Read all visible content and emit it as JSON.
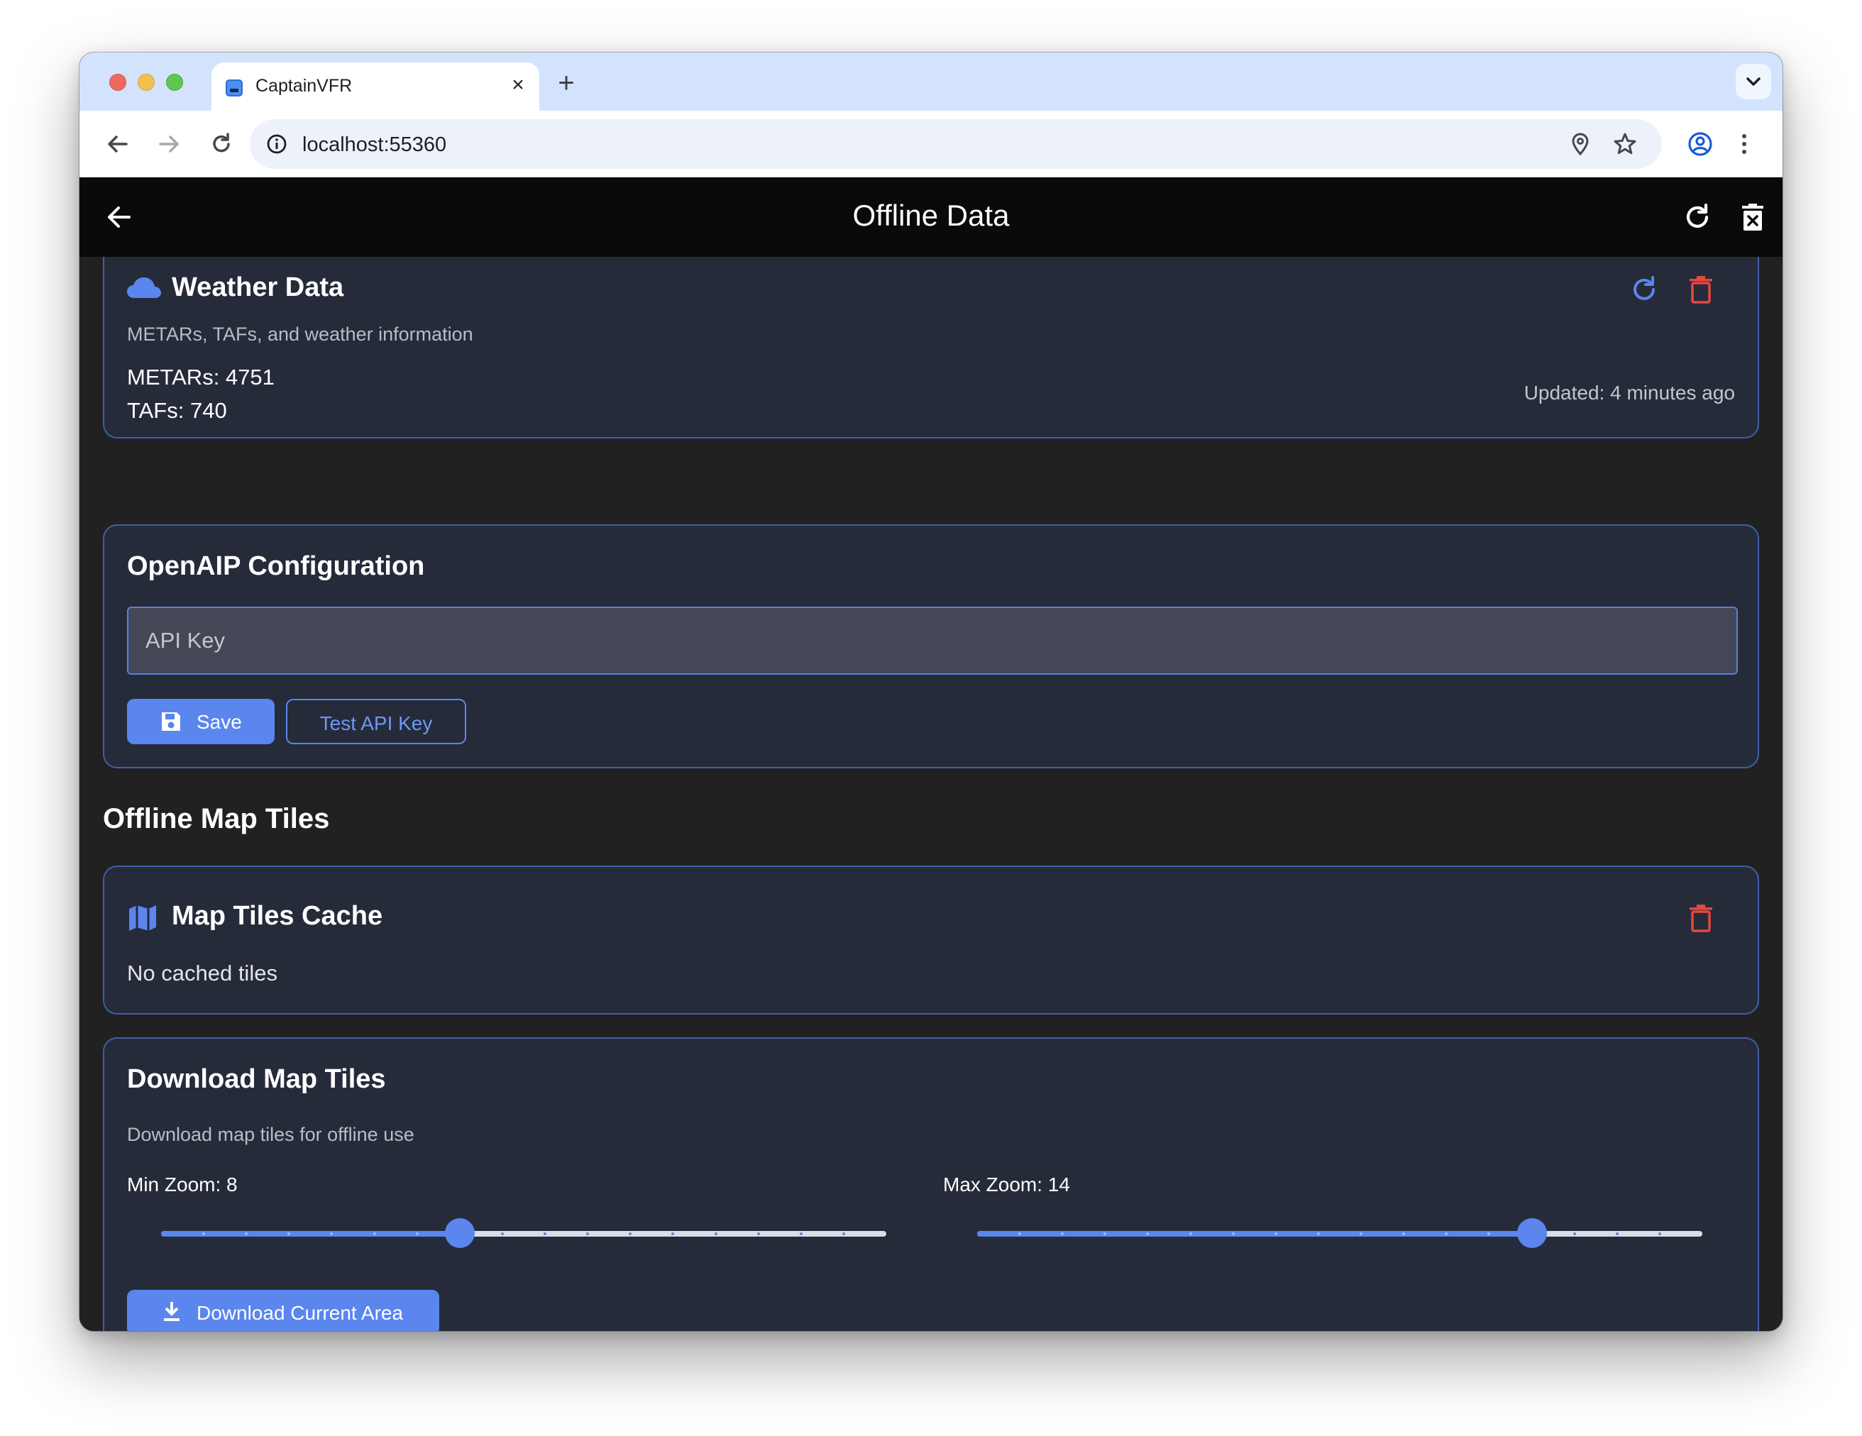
{
  "browser": {
    "tab_title": "CaptainVFR",
    "url": "localhost:55360"
  },
  "appbar": {
    "title": "Offline Data"
  },
  "weather_card": {
    "title": "Weather Data",
    "subtitle": "METARs, TAFs, and weather information",
    "metars": "METARs: 4751",
    "tafs": "TAFs: 740",
    "updated": "Updated: 4 minutes ago"
  },
  "openaip_card": {
    "title": "OpenAIP Configuration",
    "api_key_placeholder": "API Key",
    "save_label": "Save",
    "test_label": "Test API Key"
  },
  "offline_tiles": {
    "section_title": "Offline Map Tiles",
    "cache_title": "Map Tiles Cache",
    "cache_status": "No cached tiles"
  },
  "download_card": {
    "title": "Download Map Tiles",
    "subtitle": "Download map tiles for offline use",
    "min_zoom_label": "Min Zoom: 8",
    "max_zoom_label": "Max Zoom: 14",
    "min_zoom": {
      "value": 8,
      "min": 1,
      "max": 18
    },
    "max_zoom": {
      "value": 14,
      "min": 1,
      "max": 18
    },
    "download_label": "Download Current Area"
  },
  "colors": {
    "accent": "#5a86ee",
    "danger": "#e5483d",
    "card_bg": "#262b3a",
    "card_border": "#3f5fa8"
  },
  "icons": {
    "weather": "cloud-icon",
    "map": "map-icon",
    "save": "floppy-icon",
    "download": "download-icon"
  }
}
